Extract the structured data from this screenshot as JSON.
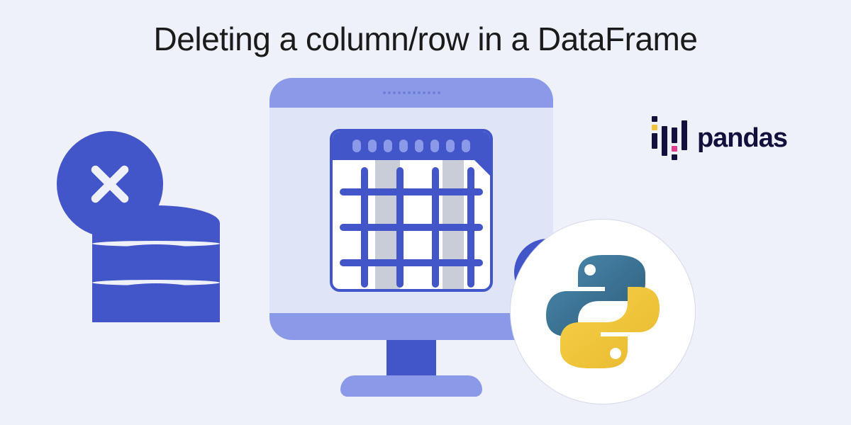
{
  "title": "Deleting a column/row in a DataFrame",
  "pandas": {
    "label": "pandas"
  },
  "icons": {
    "close": "close",
    "minus": "minus",
    "database": "database",
    "monitor": "monitor-spreadsheet",
    "python": "python-logo",
    "pandas_bars": "pandas-bars"
  },
  "colors": {
    "background": "#eef0fa",
    "primary": "#4256c9",
    "primary_light": "#8a9ae8",
    "pandas_navy": "#14103d",
    "pandas_yellow": "#f2c43d",
    "pandas_pink": "#e43b8c",
    "python_blue": "#3c6f93",
    "python_yellow": "#f2c43d"
  }
}
